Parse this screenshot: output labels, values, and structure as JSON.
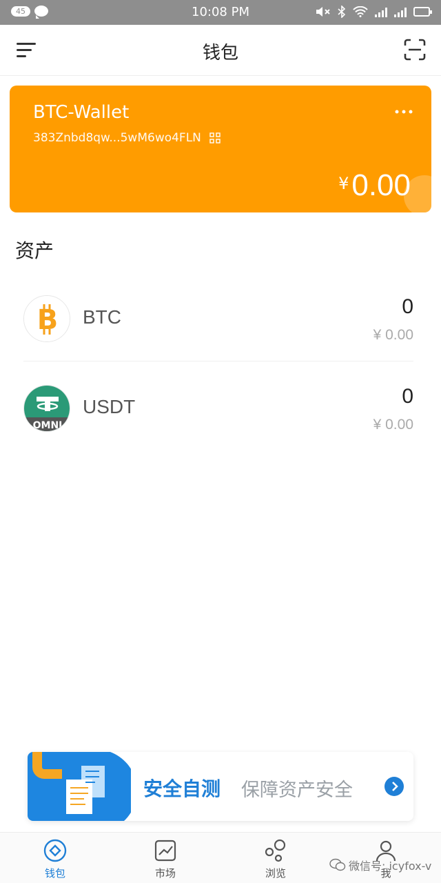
{
  "status_bar": {
    "notification_count": "45",
    "time": "10:08 PM"
  },
  "header": {
    "title": "钱包",
    "menu_icon": "menu-icon",
    "scan_icon": "scan-icon"
  },
  "wallet": {
    "name": "BTC-Wallet",
    "address": "383Znbd8qw...5wM6wo4FLN",
    "currency_symbol": "¥",
    "balance": "0.00",
    "card_color": "#ff9c00"
  },
  "assets": {
    "title": "资产",
    "items": [
      {
        "symbol": "BTC",
        "quantity": "0",
        "fiat_value": "¥ 0.00",
        "icon": "bitcoin-icon",
        "logo_label": ""
      },
      {
        "symbol": "USDT",
        "quantity": "0",
        "fiat_value": "¥ 0.00",
        "icon": "tether-omni-icon",
        "logo_label": "OMNI"
      }
    ]
  },
  "banner": {
    "main_text": "安全自测",
    "sub_text": "保障资产安全",
    "accent_color": "#1f7fd6"
  },
  "tabs": [
    {
      "label": "钱包",
      "icon": "wallet-icon",
      "active": true
    },
    {
      "label": "市场",
      "icon": "market-chart-icon",
      "active": false
    },
    {
      "label": "浏览",
      "icon": "browse-bubbles-icon",
      "active": false
    },
    {
      "label": "我",
      "icon": "profile-icon",
      "active": false
    }
  ],
  "watermark": {
    "text": "微信号: icyfox-v"
  }
}
